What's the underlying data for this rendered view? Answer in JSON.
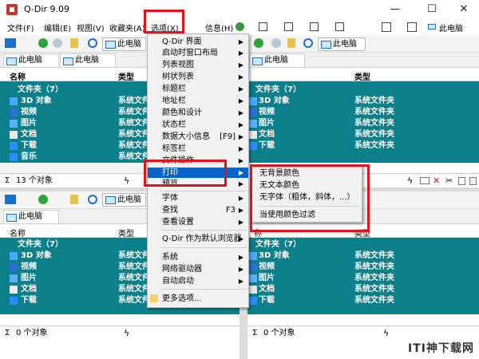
{
  "window": {
    "title": "Q-Dir 9.09",
    "buttons": [
      "—",
      "☐",
      "✕"
    ]
  },
  "menubar": [
    {
      "label": "文件(F)"
    },
    {
      "label": "编辑(E)"
    },
    {
      "label": "视图(V)"
    },
    {
      "label": "收藏夹(A)"
    },
    {
      "label": "选项(X)"
    },
    {
      "label": "信息(H)"
    }
  ],
  "address": "此电脑",
  "tab_label": "此电脑",
  "columns": {
    "name": "名称",
    "type": "类型",
    "name_short": "称"
  },
  "folder_header": "文件夹（7）",
  "items": [
    {
      "name": "3D 对象",
      "type": "系统文件夹",
      "icon": "3d-objects-icon",
      "color": "#4aa8ff"
    },
    {
      "name": "视频",
      "type": "系统文件夹",
      "icon": "video-icon",
      "color": "#2d6fd6"
    },
    {
      "name": "图片",
      "type": "系统文件夹",
      "icon": "pictures-icon",
      "color": "#5ab0ff"
    },
    {
      "name": "文档",
      "type": "系统文件夹",
      "icon": "documents-icon",
      "color": "#e9e9e9"
    },
    {
      "name": "下载",
      "type": "系统文件夹",
      "icon": "downloads-icon",
      "color": "#2d8cff"
    },
    {
      "name": "音乐",
      "type": "系统文件夹",
      "icon": "music-icon",
      "color": "#2d8cff"
    }
  ],
  "status": {
    "top_left": "13 个对象",
    "bottom_left": "0 个对象",
    "bottom_right": "0 个对象"
  },
  "options_menu": [
    {
      "label": "Q-Dir 界面",
      "arrow": true
    },
    {
      "label": "启动时窗口布局",
      "arrow": true
    },
    {
      "label": "列表视图",
      "arrow": true
    },
    {
      "label": "树状列表",
      "arrow": true
    },
    {
      "label": "标题栏",
      "arrow": true
    },
    {
      "label": "地址栏",
      "arrow": true
    },
    {
      "label": "颜色和设计",
      "arrow": true
    },
    {
      "label": "状态栏",
      "arrow": true
    },
    {
      "label": "数据大小信息",
      "shortcut": "[F9]",
      "arrow": true
    },
    {
      "label": "标签栏",
      "arrow": true
    },
    {
      "label": "文件操作",
      "arrow": true
    },
    {
      "label": "打印",
      "arrow": true,
      "highlight": true
    },
    {
      "label": "预览",
      "arrow": true
    },
    {
      "sep": true
    },
    {
      "label": "字体",
      "arrow": true
    },
    {
      "label": "查找",
      "shortcut": "F3",
      "arrow": true
    },
    {
      "label": "查看设置",
      "arrow": true
    },
    {
      "sep": true
    },
    {
      "label": "Q-Dir 作为默认浏览器",
      "arrow": true
    },
    {
      "sep": true
    },
    {
      "label": "系统",
      "arrow": true
    },
    {
      "label": "网络驱动器",
      "arrow": true
    },
    {
      "label": "自动启动",
      "arrow": true
    },
    {
      "sep": true
    },
    {
      "label": "更多选项...",
      "arrow": false
    }
  ],
  "print_submenu": [
    {
      "label": "无背景颜色"
    },
    {
      "label": "无文本颜色"
    },
    {
      "label": "无字体（粗体，斜体，...）"
    },
    {
      "sep": true
    },
    {
      "label": "当使用颜色过滤"
    }
  ],
  "watermark": "ITI神下载网",
  "colors": {
    "list_bg": "#0b7f8a",
    "highlight": "#0a64c8",
    "red_box": "#e0141c"
  }
}
